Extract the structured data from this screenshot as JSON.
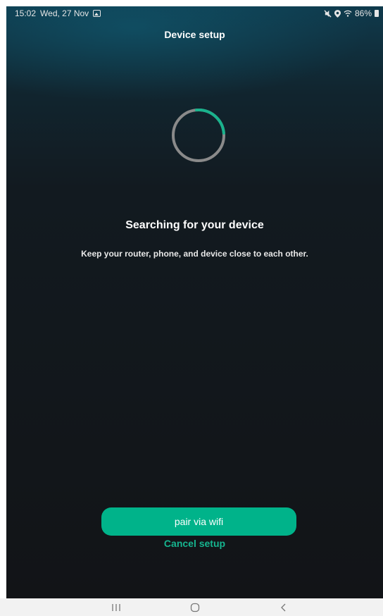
{
  "status_bar": {
    "time": "15:02",
    "date": "Wed, 27 Nov",
    "battery": "86%",
    "icons": [
      "gallery-icon",
      "mute-icon",
      "location-icon",
      "wifi-icon",
      "battery-icon"
    ]
  },
  "header": {
    "title": "Device setup"
  },
  "main": {
    "spinner_progress": 0.25,
    "heading": "Searching for your device",
    "subtext": "Keep your router, phone, and device close to each other."
  },
  "actions": {
    "pair_label": "pair via wifi",
    "cancel_label": "Cancel setup"
  },
  "colors": {
    "accent": "#00b38a",
    "spinner_track": "#8a8a8a",
    "spinner_arc": "#19b38d"
  },
  "nav_bar": {
    "icons": [
      "recents-icon",
      "home-icon",
      "back-icon"
    ]
  }
}
